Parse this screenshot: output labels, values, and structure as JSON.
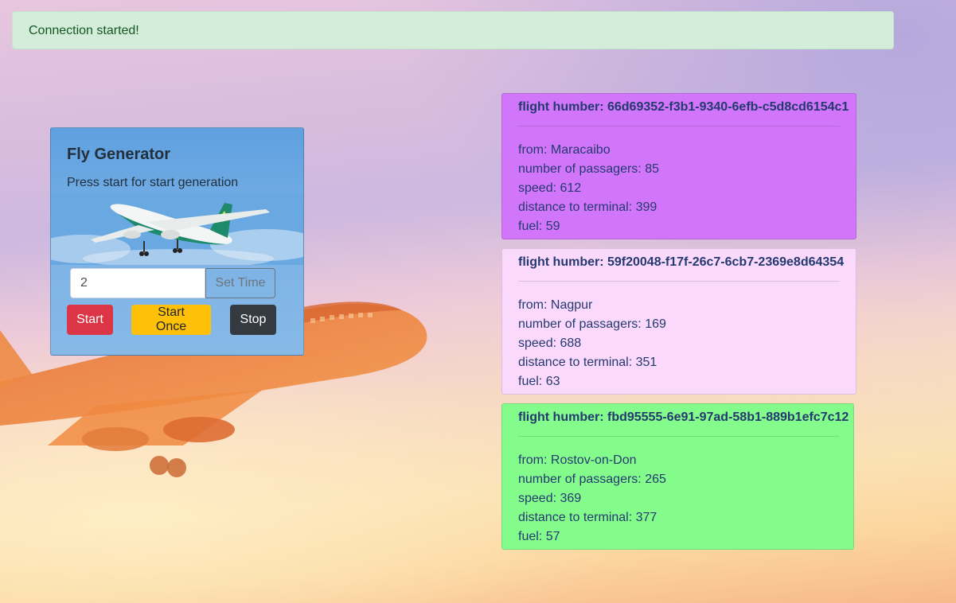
{
  "alert": {
    "text": "Connection started!",
    "color": "#d4edda"
  },
  "generator": {
    "title": "Fly Generator",
    "subtitle": "Press start for start generation",
    "interval_value": "2",
    "set_time_label": "Set Time",
    "start_label": "Start",
    "start_once_label": "Start Once",
    "stop_label": "Stop"
  },
  "flights": [
    {
      "number_label": "flight humber: 66d69352-f3b1-9340-6efb-c5d8cd6154c1",
      "from": "from: Maracaibo",
      "passengers": "number of passagers: 85",
      "speed": "speed: 612",
      "distance": "distance to terminal: 399",
      "fuel": "fuel: 59",
      "color": "#d175fb"
    },
    {
      "number_label": "flight humber: 59f20048-f17f-26c7-6cb7-2369e8d64354",
      "from": "from: Nagpur",
      "passengers": "number of passagers: 169",
      "speed": "speed: 688",
      "distance": "distance to terminal: 351",
      "fuel": "fuel: 63",
      "color": "#fbd9fd"
    },
    {
      "number_label": "flight humber: fbd95555-6e91-97ad-58b1-889b1efc7c12",
      "from": "from: Rostov-on-Don",
      "passengers": "number of passagers: 265",
      "speed": "speed: 369",
      "distance": "distance to terminal: 377",
      "fuel": "fuel: 57",
      "color": "#84fc8c"
    }
  ]
}
